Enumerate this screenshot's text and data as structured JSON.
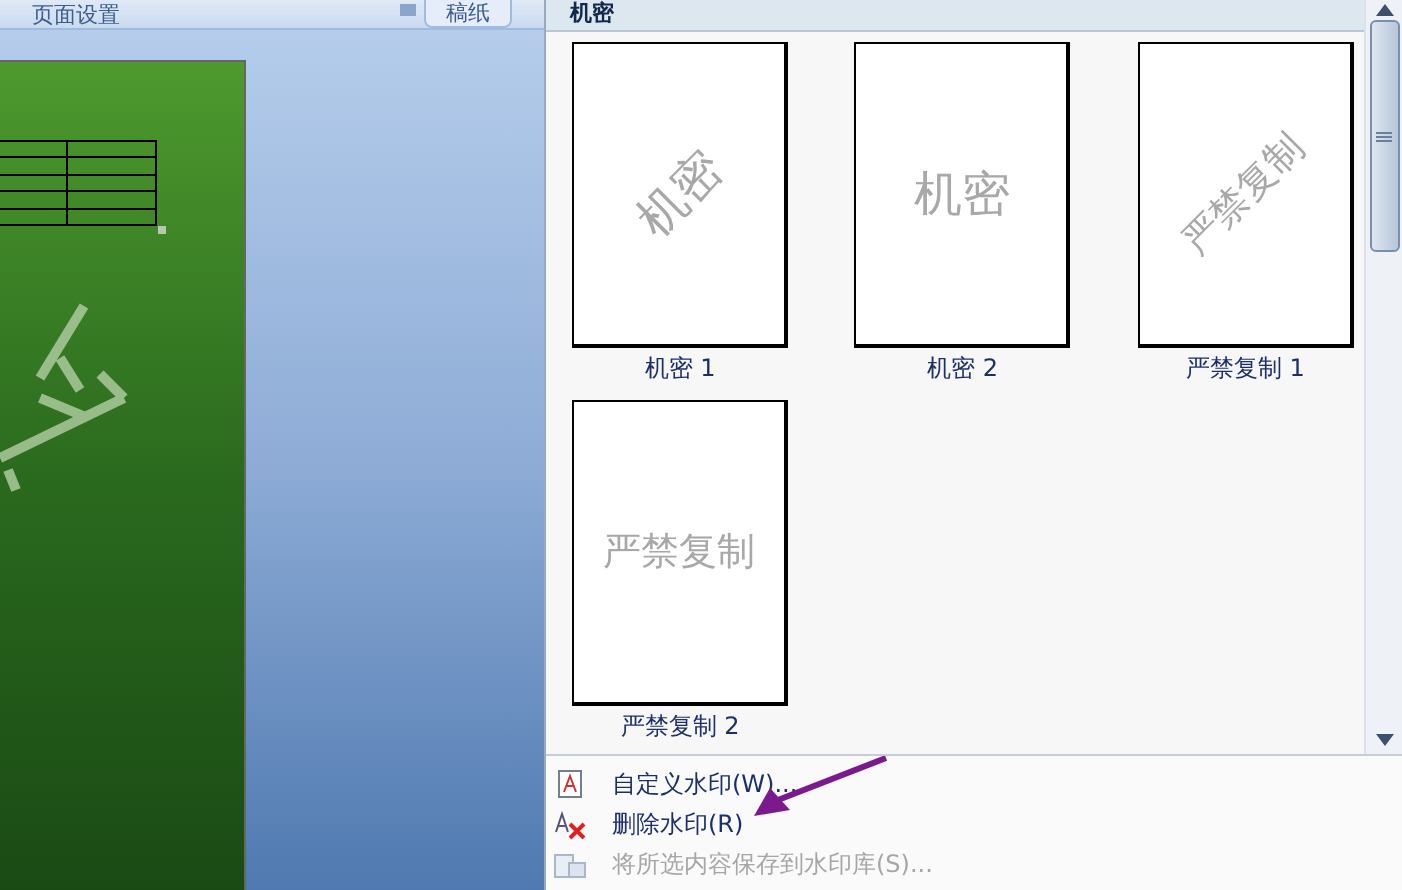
{
  "ribbon": {
    "group_label": "页面设置",
    "tab": "稿纸"
  },
  "gallery": {
    "category": "机密",
    "items": [
      {
        "caption": "机密 1",
        "watermark": "机密",
        "kind": "diagonal"
      },
      {
        "caption": "机密 2",
        "watermark": "机密",
        "kind": "horizontal"
      },
      {
        "caption": "严禁复制 1",
        "watermark": "严禁复制",
        "kind": "diagonal"
      },
      {
        "caption": "严禁复制 2",
        "watermark": "严禁复制",
        "kind": "horizontal"
      }
    ]
  },
  "menu": [
    {
      "label": "自定义水印(W)...",
      "kind": "custom",
      "disabled": false
    },
    {
      "label": "删除水印(R)",
      "kind": "remove",
      "disabled": false
    },
    {
      "label": "将所选内容保存到水印库(S)...",
      "kind": "save",
      "disabled": true
    }
  ]
}
